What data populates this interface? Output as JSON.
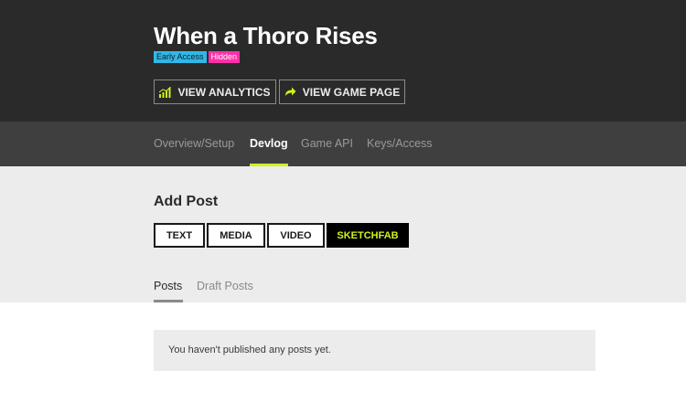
{
  "header": {
    "title": "When a Thoro Rises",
    "badges": {
      "early_access": "Early Access",
      "hidden": "Hidden"
    },
    "buttons": {
      "analytics": {
        "label": "VIEW ANALYTICS",
        "icon": "bar-chart-icon"
      },
      "game_page": {
        "label": "VIEW GAME PAGE",
        "icon": "share-arrow-icon"
      }
    }
  },
  "nav": {
    "items": [
      {
        "label": "Overview/Setup",
        "active": false
      },
      {
        "label": "Devlog",
        "active": true
      },
      {
        "label": "Game API",
        "active": false
      },
      {
        "label": "Keys/Access",
        "active": false
      }
    ]
  },
  "add_post": {
    "heading": "Add Post",
    "types": [
      "TEXT",
      "MEDIA",
      "VIDEO",
      "SKETCHFAB"
    ]
  },
  "posts_tabs": {
    "items": [
      {
        "label": "Posts",
        "active": true
      },
      {
        "label": "Draft Posts",
        "active": false
      }
    ]
  },
  "empty_message": "You haven't published any posts yet.",
  "colors": {
    "header_bg": "#2a2a2a",
    "nav_bg": "#3f3f3f",
    "accent": "#cdf321",
    "early_access": "#2fb8ea",
    "hidden": "#ff2fa8"
  }
}
